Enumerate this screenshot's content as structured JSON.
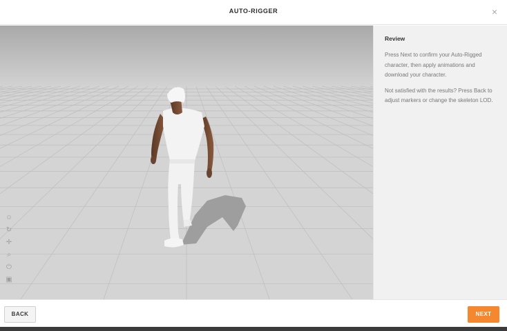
{
  "header": {
    "title": "AUTO-RIGGER",
    "close_glyph": "×"
  },
  "viewport": {
    "tools": [
      {
        "name": "head-view-icon",
        "glyph": "☺"
      },
      {
        "name": "rotate-icon",
        "glyph": "↻"
      },
      {
        "name": "pan-icon",
        "glyph": "✛"
      },
      {
        "name": "zoom-icon",
        "glyph": "⌕"
      },
      {
        "name": "power-icon",
        "glyph": "⏻"
      },
      {
        "name": "camera-icon",
        "glyph": "▣"
      }
    ]
  },
  "panel": {
    "title": "Review",
    "paragraph1": "Press Next to confirm your Auto-Rigged character, then apply animations and download your character.",
    "paragraph2": "Not satisfied with the results? Press Back to adjust markers or change the skeleton LOD."
  },
  "footer": {
    "back_label": "BACK",
    "next_label": "NEXT"
  },
  "colors": {
    "accent": "#f5872e",
    "floor": "#d4d4d4",
    "panel_bg": "#f1f1f1"
  }
}
